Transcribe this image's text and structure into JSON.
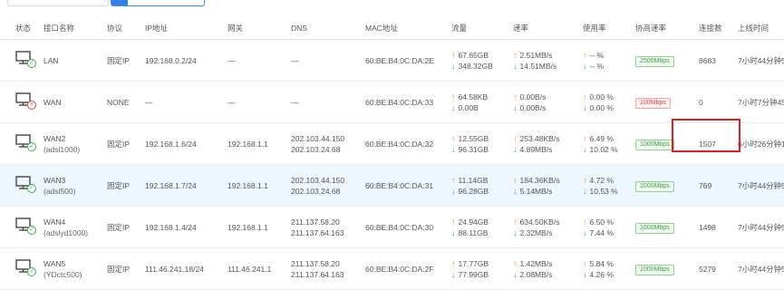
{
  "columns": [
    "状态",
    "接口名称",
    "协议",
    "IP地址",
    "网关",
    "DNS",
    "MAC地址",
    "流量",
    "速率",
    "使用率",
    "协商速率",
    "连接数",
    "上线时间"
  ],
  "rows": [
    {
      "status": "ok",
      "name": "LAN",
      "sub": "",
      "protocol": "固定IP",
      "ip": "192.168.0.2/24",
      "gateway": "—",
      "dns1": "—",
      "dns2": "",
      "mac": "60:BE:B4:0C:DA:2E",
      "traffic_up": "67.65GB",
      "traffic_down": "348.32GB",
      "rate_up": "2.51MB/s",
      "rate_down": "14.51MB/s",
      "use_up": "-- %",
      "use_down": "-- %",
      "nego": "2500Mbps",
      "nego_color": "green",
      "conns": "8683",
      "uptime": "7小时44分钟5"
    },
    {
      "status": "bad",
      "name": "WAN",
      "sub": "",
      "protocol": "NONE",
      "ip": "—",
      "gateway": "—",
      "dns1": "—",
      "dns2": "",
      "mac": "60:BE:B4:0C:DA:33",
      "traffic_up": "64.58KB",
      "traffic_down": "0.00B",
      "rate_up": "0.00B/s",
      "rate_down": "0.00B/s",
      "use_up": "0.00 %",
      "use_down": "0.00 %",
      "nego": "100Mbps",
      "nego_color": "red",
      "conns": "0",
      "uptime": "7小时7分钟45"
    },
    {
      "status": "ok",
      "name": "WAN2",
      "sub": "(adsl1000)",
      "protocol": "固定IP",
      "ip": "192.168.1.6/24",
      "gateway": "192.168.1.1",
      "dns1": "202.103.44.150",
      "dns2": "202.103.24.68",
      "mac": "60:BE:B4:0C:DA:32",
      "traffic_up": "12.55GB",
      "traffic_down": "96.31GB",
      "rate_up": "253.48KB/s",
      "rate_down": "4.89MB/s",
      "use_up": "6.49 %",
      "use_down": "10.02 %",
      "nego": "1000Mbps",
      "nego_color": "green",
      "conns": "1507",
      "uptime": "6小时26分钟1"
    },
    {
      "status": "ok",
      "name": "WAN3",
      "sub": "(adsl500)",
      "protocol": "固定IP",
      "ip": "192.168.1.7/24",
      "gateway": "192.168.1.1",
      "dns1": "202.103.44.150",
      "dns2": "202.103.24.68",
      "mac": "60:BE:B4:0C:DA:31",
      "traffic_up": "11.14GB",
      "traffic_down": "96.28GB",
      "rate_up": "184.36KB/s",
      "rate_down": "5.14MB/s",
      "use_up": "4.72 %",
      "use_down": "10.53 %",
      "nego": "1000Mbps",
      "nego_color": "green",
      "conns": "769",
      "uptime": "7小时44分钟5"
    },
    {
      "status": "ok",
      "name": "WAN4",
      "sub": "(adslyd1000)",
      "protocol": "固定IP",
      "ip": "192.168.1.4/24",
      "gateway": "192.168.1.1",
      "dns1": "211.137.58.20",
      "dns2": "211.137.64.163",
      "mac": "60:BE:B4:0C:DA:30",
      "traffic_up": "24.94GB",
      "traffic_down": "88.11GB",
      "rate_up": "634.50KB/s",
      "rate_down": "2.32MB/s",
      "use_up": "6.50 %",
      "use_down": "7.44 %",
      "nego": "1000Mbps",
      "nego_color": "green",
      "conns": "1498",
      "uptime": "7小时44分钟5"
    },
    {
      "status": "ok",
      "name": "WAN5",
      "sub": "(YDctc500)",
      "protocol": "固定IP",
      "ip": "111.46.241.18/24",
      "gateway": "111.46.241.1",
      "dns1": "211.137.58.20",
      "dns2": "211.137.64.163",
      "mac": "60:BE:B4:0C:DA:2F",
      "traffic_up": "17.77GB",
      "traffic_down": "77.99GB",
      "rate_up": "1.42MB/s",
      "rate_down": "2.08MB/s",
      "use_up": "5.84 %",
      "use_down": "4.26 %",
      "nego": "1000Mbps",
      "nego_color": "green",
      "conns": "5279",
      "uptime": "7小时44分钟5"
    }
  ]
}
